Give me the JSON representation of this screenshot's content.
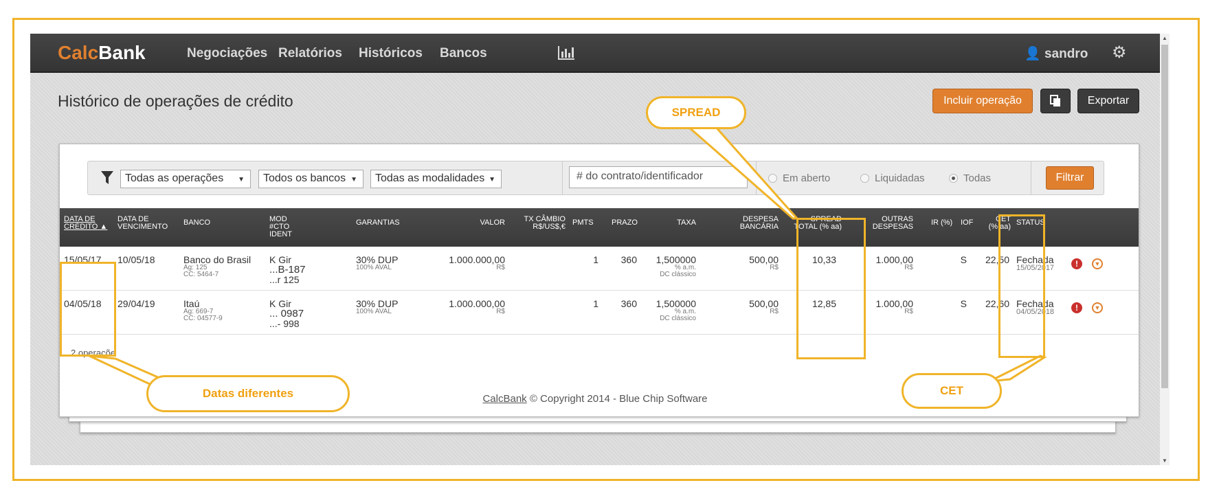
{
  "nav": {
    "logo_calc": "Calc",
    "logo_bank": "Bank",
    "links": [
      "Negociações",
      "Relatórios",
      "Históricos",
      "Bancos"
    ],
    "chart_icon": "bar-chart-icon",
    "user": "sandro",
    "user_icon": "user-icon",
    "settings_icon": "gear-icon"
  },
  "page": {
    "title": "Histórico de operações de crédito",
    "include_btn": "Incluir operação",
    "copy_icon": "copy-icon",
    "export_btn": "Exportar"
  },
  "filters": {
    "filter_icon": "funnel-icon",
    "operations": "Todas as operações",
    "banks": "Todos os bancos",
    "modalities": "Todas as modalidades",
    "search_placeholder": "# do contrato/identificador",
    "radio_open": "Em aberto",
    "radio_settled": "Liquidadas",
    "radio_all": "Todas",
    "radio_selected": "Todas",
    "submit": "Filtrar"
  },
  "table": {
    "headers": {
      "data_credito_1": "DATA DE",
      "data_credito_2": "CRÉDITO",
      "sort_arrow": "▲",
      "data_venc_1": "DATA DE",
      "data_venc_2": "VENCIMENTO",
      "banco": "BANCO",
      "mod_1": "MOD",
      "mod_2": "#CTO",
      "mod_3": "IDENT",
      "garantias": "GARANTIAS",
      "valor": "VALOR",
      "tx_1": "TX CÂMBIO",
      "tx_2": "R$/US$,€",
      "pmts": "PMTS",
      "prazo": "PRAZO",
      "taxa": "TAXA",
      "despesa_1": "DESPESA",
      "despesa_2": "BANCÁRIA",
      "spread_1": "SPREAD",
      "spread_2": "TOTAL (% aa)",
      "outras_1": "OUTRAS",
      "outras_2": "DESPESAS",
      "ir": "IR (%)",
      "iof": "IOF",
      "cet_1": "CET",
      "cet_2": "(% aa)",
      "status": "STATUS"
    },
    "rows": [
      {
        "data_credito": "15/05/17",
        "data_venc": "10/05/18",
        "banco": "Banco do Brasil",
        "ag": "Ag: 125",
        "cc": "CC: 5464-7",
        "mod": "K Gir",
        "cto": "...B-187",
        "ident": "...r 125",
        "garantia": "30% DUP",
        "aval": "100% AVAL",
        "valor": "1.000.000,00",
        "valor_moeda": "R$",
        "pmts": "1",
        "prazo": "360",
        "taxa": "1,500000",
        "taxa_unid": "% a.m.",
        "taxa_tipo": "DC clássico",
        "despesa": "500,00",
        "despesa_moeda": "R$",
        "spread": "10,33",
        "outras": "1.000,00",
        "outras_moeda": "R$",
        "iof": "S",
        "cet": "22,50",
        "status": "Fechada",
        "status_date": "15/05/2017"
      },
      {
        "data_credito": "04/05/18",
        "data_venc": "29/04/19",
        "banco": "Itaú",
        "ag": "Ag: 669-7",
        "cc": "CC: 04577-9",
        "mod": "K Gir",
        "cto": "... 0987",
        "ident": "...- 998",
        "garantia": "30% DUP",
        "aval": "100% AVAL",
        "valor": "1.000.000,00",
        "valor_moeda": "R$",
        "pmts": "1",
        "prazo": "360",
        "taxa": "1,500000",
        "taxa_unid": "% a.m.",
        "taxa_tipo": "DC clássico",
        "despesa": "500,00",
        "despesa_moeda": "R$",
        "spread": "12,85",
        "outras": "1.000,00",
        "outras_moeda": "R$",
        "iof": "S",
        "cet": "22,60",
        "status": "Fechada",
        "status_date": "04/05/2018"
      }
    ],
    "count": "2 operaçõe"
  },
  "footer": {
    "link": "CalcBank",
    "copy": " © Copyright 2014 - Blue Chip Software"
  },
  "annotations": {
    "spread": "SPREAD",
    "dates": "Datas diferentes",
    "cet": "CET"
  },
  "colors": {
    "accent": "#e0802f",
    "highlight": "#f0b429",
    "navbar": "#3b3b3b",
    "alert": "#c9302c"
  }
}
